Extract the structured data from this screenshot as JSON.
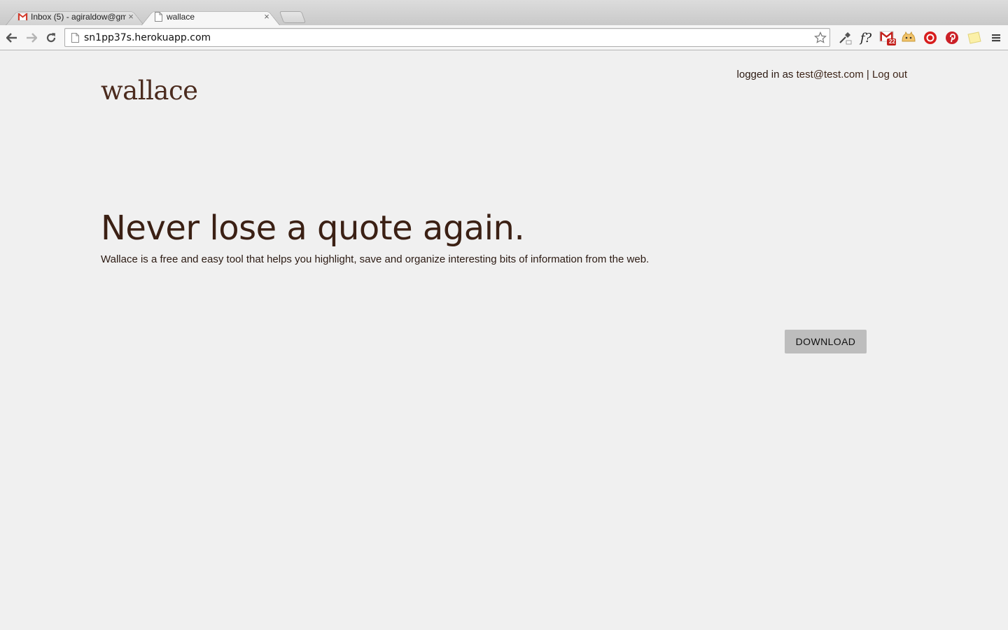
{
  "browser": {
    "tabs": [
      {
        "title": "Inbox (5) - agiraldow@gm",
        "favicon": "gmail-icon",
        "close": "×",
        "active": false
      },
      {
        "title": "wallace",
        "favicon": "page-icon",
        "close": "×",
        "active": true
      }
    ],
    "address_bar": {
      "url": "sn1pp37s.herokuapp.com"
    },
    "extensions": [
      {
        "name": "eyedropper-icon"
      },
      {
        "name": "font-question-icon",
        "label": "f?"
      },
      {
        "name": "gmail-checker-icon",
        "badge": "22"
      },
      {
        "name": "cat-icon"
      },
      {
        "name": "stop-icon"
      },
      {
        "name": "pinterest-icon"
      },
      {
        "name": "sticky-note-icon"
      },
      {
        "name": "menu-icon"
      }
    ]
  },
  "site": {
    "logo": "wallace",
    "account": {
      "prefix": "logged in as",
      "email": "test@test.com",
      "separator": "|",
      "logout": "Log out"
    },
    "hero": {
      "headline": "Never lose a quote again.",
      "tagline": "Wallace is a free and easy tool that helps you highlight, save and organize interesting bits of information from the web."
    },
    "download_label": "DOWNLOAD"
  },
  "colors": {
    "page_background": "#f0f0f0",
    "brand_brown": "#3b2014",
    "button_gray": "#bdbdbd"
  }
}
